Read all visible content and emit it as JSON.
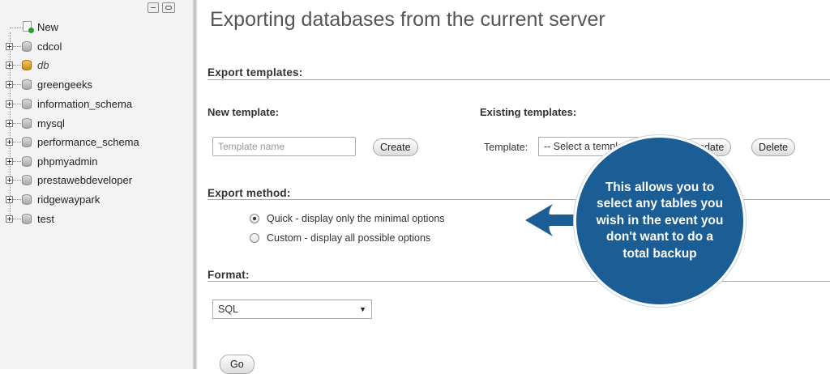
{
  "sidebar": {
    "new_label": "New",
    "databases": [
      {
        "name": "cdcol",
        "italic": false,
        "special": false
      },
      {
        "name": "db",
        "italic": true,
        "special": true
      },
      {
        "name": "greengeeks",
        "italic": false,
        "special": false
      },
      {
        "name": "information_schema",
        "italic": false,
        "special": false
      },
      {
        "name": "mysql",
        "italic": false,
        "special": false
      },
      {
        "name": "performance_schema",
        "italic": false,
        "special": false
      },
      {
        "name": "phpmyadmin",
        "italic": false,
        "special": false
      },
      {
        "name": "prestawebdeveloper",
        "italic": false,
        "special": false
      },
      {
        "name": "ridgewaypark",
        "italic": false,
        "special": false
      },
      {
        "name": "test",
        "italic": false,
        "special": false
      }
    ]
  },
  "main": {
    "title": "Exporting databases from the current server",
    "templates": {
      "heading": "Export templates:",
      "new_template_heading": "New template:",
      "template_name_placeholder": "Template name",
      "create_label": "Create",
      "existing_templates_heading": "Existing templates:",
      "template_label": "Template:",
      "template_select_value": "-- Select a template --",
      "update_label": "Update",
      "delete_label": "Delete"
    },
    "method": {
      "heading": "Export method:",
      "options": [
        {
          "label": "Quick - display only the minimal options",
          "checked": true
        },
        {
          "label": "Custom - display all possible options",
          "checked": false
        }
      ]
    },
    "format": {
      "heading": "Format:",
      "value": "SQL"
    },
    "go_label": "Go"
  },
  "callout": {
    "text": "This allows you to select any tables you wish in the event you don't want to do a total backup",
    "color": "#1a5e95"
  }
}
